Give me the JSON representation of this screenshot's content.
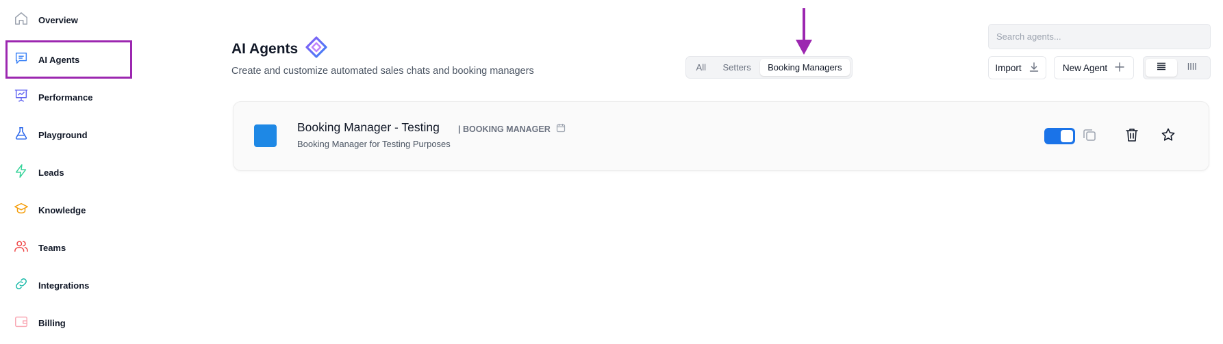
{
  "sidebar": {
    "items": [
      {
        "label": "Overview",
        "icon": "home-icon",
        "color": "#9ca3af"
      },
      {
        "label": "AI Agents",
        "icon": "chat-icon",
        "color": "#3b82f6",
        "selected": true
      },
      {
        "label": "Performance",
        "icon": "presentation-chart-icon",
        "color": "#6366f1"
      },
      {
        "label": "Playground",
        "icon": "flask-icon",
        "color": "#2563eb"
      },
      {
        "label": "Leads",
        "icon": "lightning-icon",
        "color": "#34d399"
      },
      {
        "label": "Knowledge",
        "icon": "graduation-cap-icon",
        "color": "#f59e0b"
      },
      {
        "label": "Teams",
        "icon": "users-icon",
        "color": "#ef4444"
      },
      {
        "label": "Integrations",
        "icon": "link-icon",
        "color": "#14b8a6"
      },
      {
        "label": "Billing",
        "icon": "wallet-icon",
        "color": "#f9a8b4"
      }
    ]
  },
  "header": {
    "title": "AI Agents",
    "subtitle": "Create and customize automated sales chats and booking managers"
  },
  "filters": {
    "tabs": [
      {
        "label": "All",
        "active": false
      },
      {
        "label": "Setters",
        "active": false
      },
      {
        "label": "Booking Managers",
        "active": true
      }
    ]
  },
  "search": {
    "placeholder": "Search agents...",
    "value": ""
  },
  "actions": {
    "import_label": "Import",
    "new_agent_label": "New Agent"
  },
  "view_modes": [
    {
      "icon": "list-view-icon",
      "active": true
    },
    {
      "icon": "columns-view-icon",
      "active": false
    }
  ],
  "agents": [
    {
      "name": "Booking Manager - Testing",
      "type": "| BOOKING MANAGER",
      "description": "Booking Manager for Testing Purposes",
      "avatar_color": "#1e88e5",
      "enabled": true
    }
  ],
  "colors": {
    "accent_purple": "#9c27b0",
    "toggle_blue": "#1a73e8"
  }
}
